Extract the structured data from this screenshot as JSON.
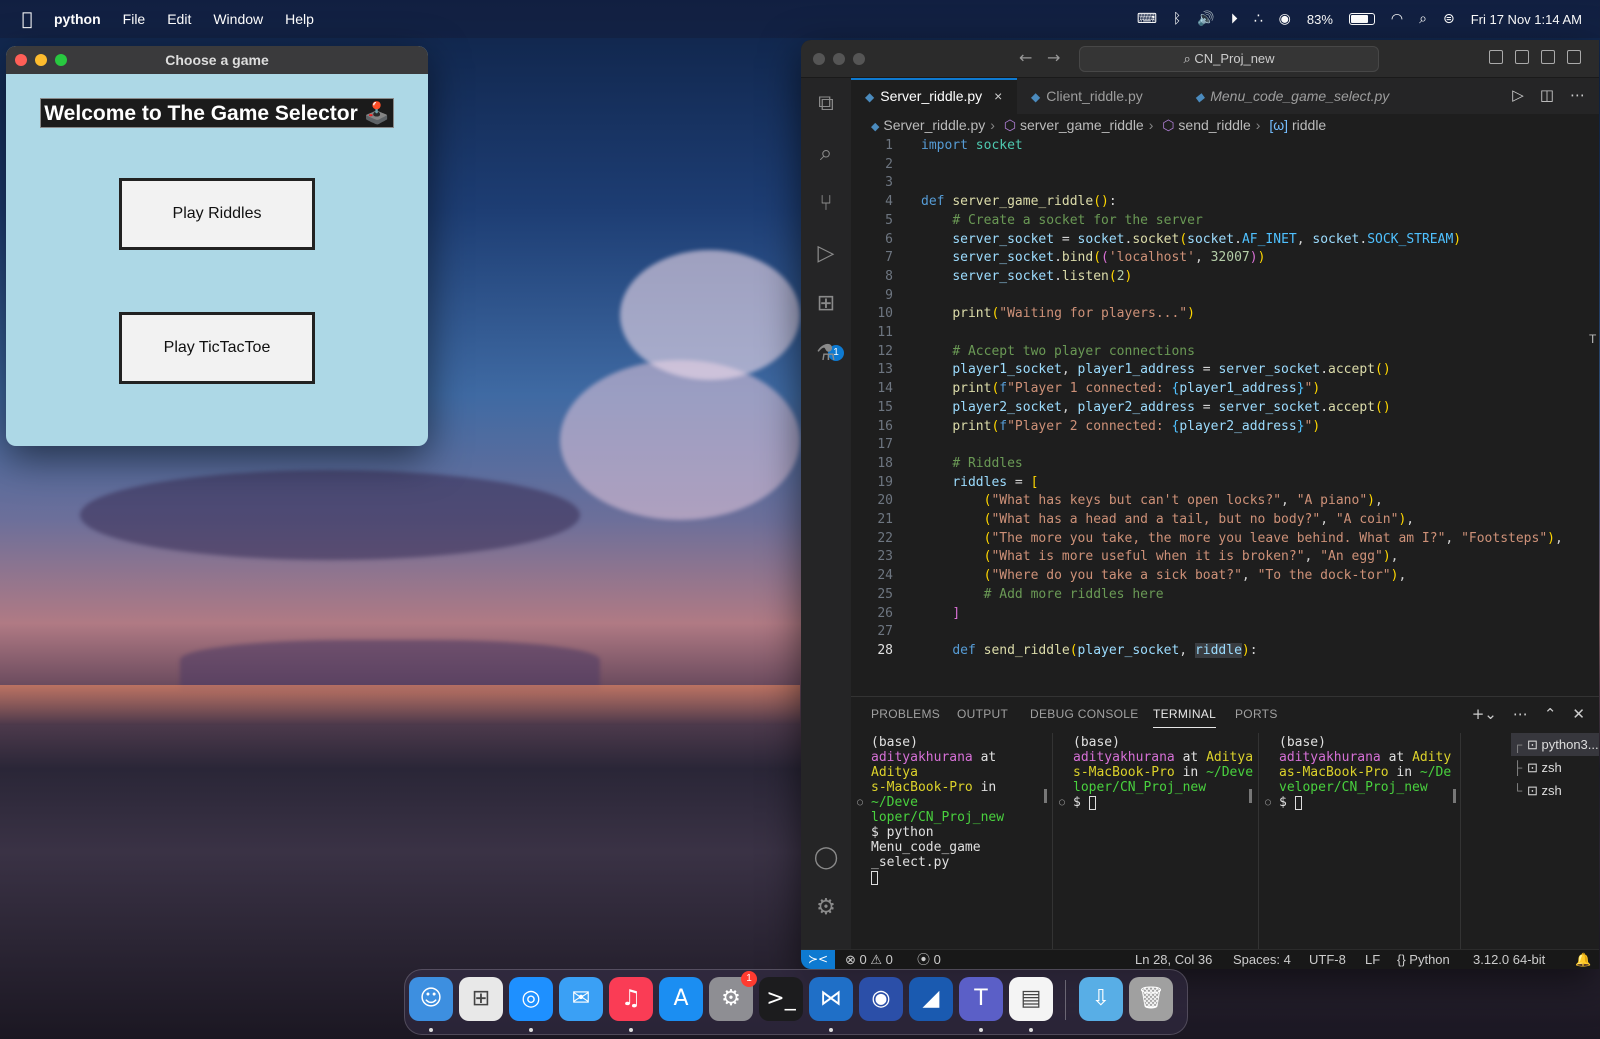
{
  "menubar": {
    "app": "python",
    "items": [
      "File",
      "Edit",
      "Window",
      "Help"
    ],
    "battery": "83%",
    "battery_level": 0.83,
    "datetime": "Fri 17 Nov  1:14 AM"
  },
  "game_window": {
    "title": "Choose a game",
    "heading": "Welcome to The Game Selector 🕹️",
    "buttons": [
      "Play Riddles",
      "Play TicTacToe"
    ]
  },
  "vscode": {
    "search": "CN_Proj_new",
    "tabs": [
      {
        "label": "Server_riddle.py",
        "close": "×"
      },
      {
        "label": "Client_riddle.py"
      },
      {
        "label": "Menu_code_game_select.py"
      }
    ],
    "breadcrumb": [
      "Server_riddle.py",
      "server_game_riddle",
      "send_riddle",
      "riddle"
    ],
    "extensions_badge": "1",
    "code_lines": [
      "import socket",
      "",
      "",
      "def server_game_riddle():",
      "    # Create a socket for the server",
      "    server_socket = socket.socket(socket.AF_INET, socket.SOCK_STREAM)",
      "    server_socket.bind(('localhost', 32007))",
      "    server_socket.listen(2)",
      "",
      "    print(\"Waiting for players...\")",
      "",
      "    # Accept two player connections",
      "    player1_socket, player1_address = server_socket.accept()",
      "    print(f\"Player 1 connected: {player1_address}\")",
      "    player2_socket, player2_address = server_socket.accept()",
      "    print(f\"Player 2 connected: {player2_address}\")",
      "",
      "    # Riddles",
      "    riddles = [",
      "        (\"What has keys but can't open locks?\", \"A piano\"),",
      "        (\"What has a head and a tail, but no body?\", \"A coin\"),",
      "        (\"The more you take, the more you leave behind. What am I?\", \"Footsteps\"),",
      "        (\"What is more useful when it is broken?\", \"An egg\"),",
      "        (\"Where do you take a sick boat?\", \"To the dock-tor\"),",
      "        # Add more riddles here",
      "    ]",
      "",
      "    def send_riddle(player_socket, riddle):"
    ],
    "current_line": 28,
    "panel_tabs": [
      "PROBLEMS",
      "OUTPUT",
      "DEBUG CONSOLE",
      "TERMINAL",
      "PORTS"
    ],
    "active_panel_tab": "TERMINAL",
    "terminals": [
      {
        "env": "(base)",
        "user": "adityakhurana",
        "at": " at ",
        "host": "Aditya\ns-MacBook-Pro",
        "in": " in ",
        "path": "~/Deve\nloper/CN_Proj_new",
        "command": "$ python Menu_code_game\n_select.py"
      },
      {
        "env": "(base)",
        "user": "adityakhurana",
        "at": " at ",
        "host": "Aditya\ns-MacBook-Pro",
        "in": " in ",
        "path": "~/Deve\nloper/CN_Proj_new",
        "command": "$ "
      },
      {
        "env": "(base)",
        "user": "adityakhurana",
        "at": " at ",
        "host": "Adity\nas-MacBook-Pro",
        "in": " in ",
        "path": "~/De\nveloper/CN_Proj_new",
        "command": "$ "
      }
    ],
    "terminal_list": [
      "python3...",
      "zsh",
      "zsh"
    ],
    "status": {
      "errors": "0",
      "warnings": "0",
      "ports": "0",
      "position": "Ln 28, Col 36",
      "spaces": "Spaces: 4",
      "encoding": "UTF-8",
      "eol": "LF",
      "language": "Python",
      "interpreter": "3.12.0 64-bit"
    }
  },
  "dock": {
    "apps": [
      "Finder",
      "Launchpad",
      "Safari",
      "Mail",
      "Music",
      "App Store",
      "System Settings",
      "Terminal",
      "Visual Studio Code",
      "PyCharm",
      "Wireshark",
      "Teams",
      "TextEdit",
      "Downloads",
      "Trash"
    ],
    "settings_badge": "1"
  }
}
